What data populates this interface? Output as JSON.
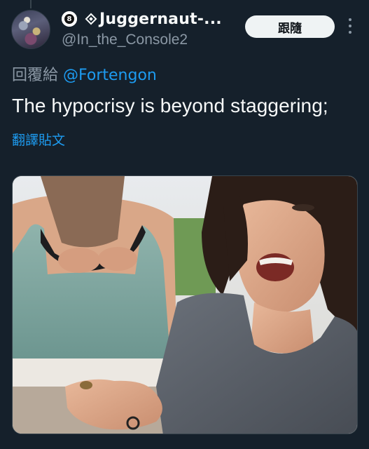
{
  "author": {
    "display_name": "Juggernaut-...",
    "handle": "@In_the_Console2",
    "badge_number": "8",
    "avatar_icon": "avatar-image",
    "badge_icon": "eight-ball-icon",
    "second_badge_icon": "diamond-icon"
  },
  "actions": {
    "follow_label": "跟隨",
    "more_icon": "more-vertical-icon"
  },
  "reply": {
    "prefix": "回覆給 ",
    "mention": "@Fortengon"
  },
  "tweet": {
    "text": "The hypocrisy is beyond staggering;",
    "translate_label": "翻譯貼文"
  },
  "media": {
    "type": "photo",
    "icon": "photo-image"
  },
  "colors": {
    "background": "#15202b",
    "accent": "#1d9bf0",
    "secondary_text": "#8b98a5",
    "button_bg": "#eff3f4"
  }
}
